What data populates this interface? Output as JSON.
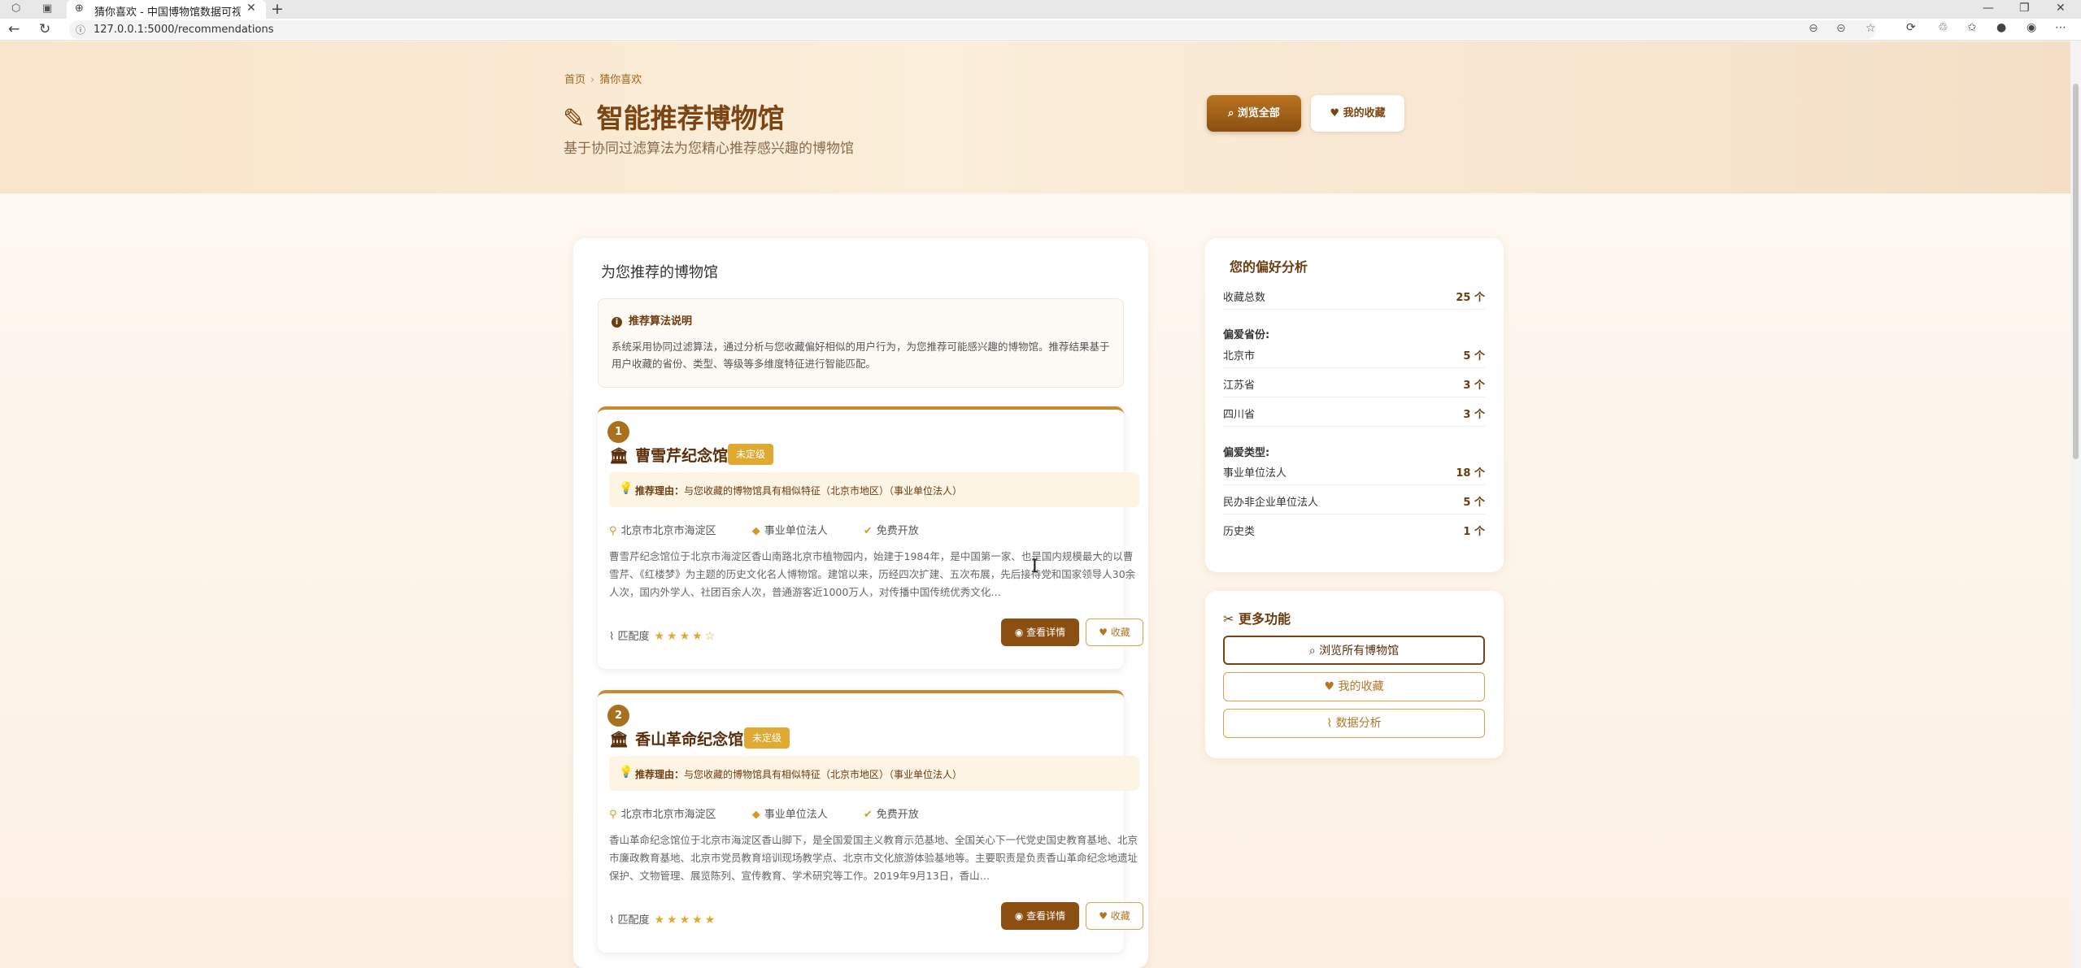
{
  "browser": {
    "tab_title": "猜你喜欢 - 中国博物馆数据可视化",
    "url": "127.0.0.1:5000/recommendations"
  },
  "breadcrumb": {
    "home": "首页",
    "current": "猜你喜欢"
  },
  "header": {
    "title": "智能推荐博物馆",
    "subtitle": "基于协同过滤算法为您精心推荐感兴趣的博物馆",
    "browse_all": "浏览全部",
    "my_favorites": "我的收藏"
  },
  "main": {
    "title": "为您推荐的博物馆",
    "algo_title": "推荐算法说明",
    "algo_text": "系统采用协同过滤算法，通过分析与您收藏偏好相似的用户行为，为您推荐可能感兴趣的博物馆。推荐结果基于用户收藏的省份、类型、等级等多维度特征进行智能匹配。",
    "items": [
      {
        "rank": "1",
        "name": "曹雪芹纪念馆",
        "level": "未定级",
        "reason_label": "推荐理由：",
        "reason": "与您收藏的博物馆具有相似特征（北京市地区）（事业单位法人）",
        "location": "北京市北京市海淀区",
        "type": "事业单位法人",
        "free": "免费开放",
        "description": "曹雪芹纪念馆位于北京市海淀区香山南路北京市植物园内，始建于1984年，是中国第一家、也是国内规模最大的以曹雪芹、《红楼梦》为主题的历史文化名人博物馆。建馆以来，历经四次扩建、五次布展，先后接待党和国家领导人30余人次，国内外学人、社团百余人次，普通游客近1000万人，对传播中国传统优秀文化…",
        "match_label": "匹配度",
        "stars": 4,
        "detail_btn": "查看详情",
        "collect_btn": "收藏"
      },
      {
        "rank": "2",
        "name": "香山革命纪念馆",
        "level": "未定级",
        "reason_label": "推荐理由：",
        "reason": "与您收藏的博物馆具有相似特征（北京市地区）（事业单位法人）",
        "location": "北京市北京市海淀区",
        "type": "事业单位法人",
        "free": "免费开放",
        "description": "香山革命纪念馆位于北京市海淀区香山脚下，是全国爱国主义教育示范基地、全国关心下一代党史国史教育基地、北京市廉政教育基地、北京市党员教育培训现场教学点、北京市文化旅游体验基地等。主要职责是负责香山革命纪念地遗址保护、文物管理、展览陈列、宣传教育、学术研究等工作。2019年9月13日，香山…",
        "match_label": "匹配度",
        "stars": 5,
        "detail_btn": "查看详情",
        "collect_btn": "收藏"
      }
    ]
  },
  "preferences": {
    "title": "您的偏好分析",
    "total_label": "收藏总数",
    "total_value": "25 个",
    "province_title": "偏爱省份:",
    "provinces": [
      {
        "name": "北京市",
        "count": "5 个"
      },
      {
        "name": "江苏省",
        "count": "3 个"
      },
      {
        "name": "四川省",
        "count": "3 个"
      }
    ],
    "type_title": "偏爱类型:",
    "types": [
      {
        "name": "事业单位法人",
        "count": "18 个"
      },
      {
        "name": "民办非企业单位法人",
        "count": "5 个"
      },
      {
        "name": "历史类",
        "count": "1 个"
      }
    ]
  },
  "more": {
    "title": "更多功能",
    "browse_all": "浏览所有博物馆",
    "my_favorites": "我的收藏",
    "analysis": "数据分析"
  },
  "colors": {
    "accent": "#8b4f12",
    "gold": "#e0a931",
    "header_bg": "#f8e4c9"
  }
}
